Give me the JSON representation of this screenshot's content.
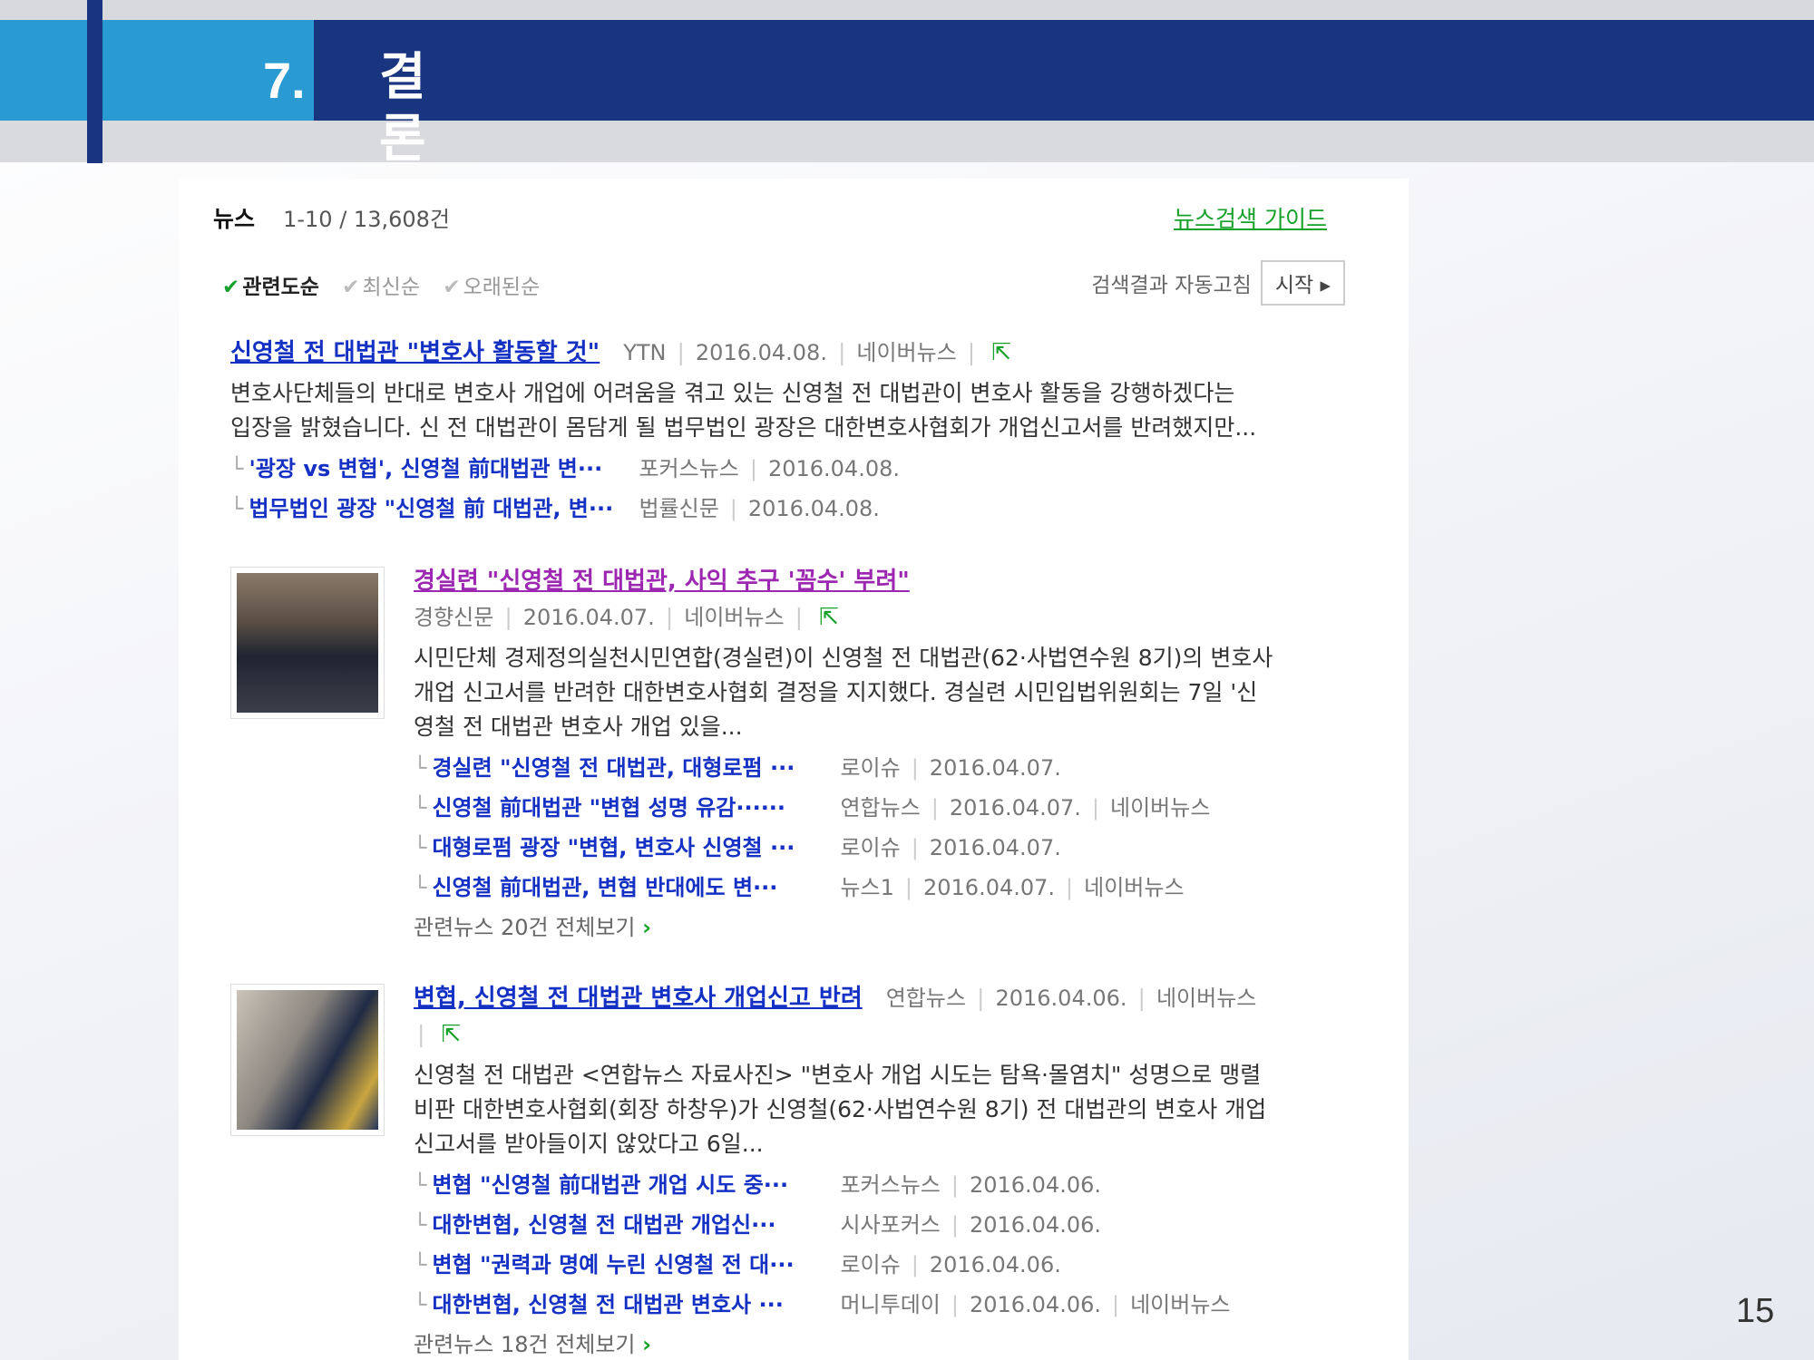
{
  "slide": {
    "section_number": "7.",
    "section_title": "결론",
    "page_number": "15"
  },
  "search": {
    "tab_title": "뉴스",
    "result_count": "1-10 / 13,608건",
    "guide_link": "뉴스검색 가이드",
    "sort_options": [
      "관련도순",
      "최신순",
      "오래된순"
    ],
    "auto_refresh_label": "검색결과 자동고침",
    "start_button": "시작 ▸"
  },
  "results": [
    {
      "title": "신영철 전 대법관 \"변호사 활동할 것\"",
      "source": "YTN",
      "date": "2016.04.08.",
      "portal": "네이버뉴스",
      "desc_lines": [
        "변호사단체들의 반대로 변호사 개업에 어려움을 겪고 있는 신영철 전 대법관이 변호사 활동을 강행하겠다는",
        "입장을 밝혔습니다. 신 전 대법관이 몸담게 될 법무법인 광장은 대한변호사협회가 개업신고서를 반려했지만..."
      ],
      "related": [
        {
          "title": "'광장 vs 변협', 신영철 前대법관 변···",
          "source": "포커스뉴스",
          "date": "2016.04.08.",
          "portal": ""
        },
        {
          "title": "법무법인 광장 \"신영철 前 대법관, 변···",
          "source": "법률신문",
          "date": "2016.04.08.",
          "portal": ""
        }
      ]
    },
    {
      "title": "경실련 \"신영철 전 대법관, 사익 추구 '꼼수' 부려\"",
      "source": "경향신문",
      "date": "2016.04.07.",
      "portal": "네이버뉴스",
      "desc_lines": [
        "시민단체 경제정의실천시민연합(경실련)이 신영철 전 대법관(62·사법연수원 8기)의 변호사",
        "개업 신고서를 반려한 대한변호사협회 결정을 지지했다. 경실련 시민입법위원회는 7일 '신",
        "영철 전 대법관 변호사 개업 있을..."
      ],
      "related": [
        {
          "title": "경실련 \"신영철 전 대법관, 대형로펌 ···",
          "source": "로이슈",
          "date": "2016.04.07.",
          "portal": ""
        },
        {
          "title": "신영철 前대법관 \"변협 성명 유감······",
          "source": "연합뉴스",
          "date": "2016.04.07.",
          "portal": "네이버뉴스"
        },
        {
          "title": "대형로펌 광장 \"변협, 변호사 신영철 ···",
          "source": "로이슈",
          "date": "2016.04.07.",
          "portal": ""
        },
        {
          "title": "신영철 前대법관, 변협 반대에도 변···",
          "source": "뉴스1",
          "date": "2016.04.07.",
          "portal": "네이버뉴스"
        }
      ],
      "more_link": "관련뉴스 20건 전체보기"
    },
    {
      "title": "변협, 신영철 전 대법관 변호사 개업신고 반려",
      "source": "연합뉴스",
      "date": "2016.04.06.",
      "portal": "네이버뉴스",
      "desc_lines": [
        "신영철 전 대법관 <연합뉴스 자료사진> \"변호사 개업 시도는 탐욕·몰염치\" 성명으로 맹렬",
        "비판 대한변호사협회(회장 하창우)가 신영철(62·사법연수원 8기) 전 대법관의 변호사 개업",
        "신고서를 받아들이지 않았다고 6일..."
      ],
      "related": [
        {
          "title": "변협 \"신영철 前대법관 개업 시도 중···",
          "source": "포커스뉴스",
          "date": "2016.04.06.",
          "portal": ""
        },
        {
          "title": "대한변협, 신영철 전 대법관 개업신···",
          "source": "시사포커스",
          "date": "2016.04.06.",
          "portal": ""
        },
        {
          "title": "변협 \"권력과 명예 누린 신영철 전 대···",
          "source": "로이슈",
          "date": "2016.04.06.",
          "portal": ""
        },
        {
          "title": "대한변협, 신영철 전 대법관 변호사 ···",
          "source": "머니투데이",
          "date": "2016.04.06.",
          "portal": "네이버뉴스"
        }
      ],
      "more_link": "관련뉴스 18건 전체보기"
    }
  ],
  "colors": {
    "navy": "#1a3580",
    "cyan": "#2a9ad3",
    "link_blue": "#1431c4",
    "visited_purple": "#9c27b0",
    "naver_green": "#16a12a"
  }
}
